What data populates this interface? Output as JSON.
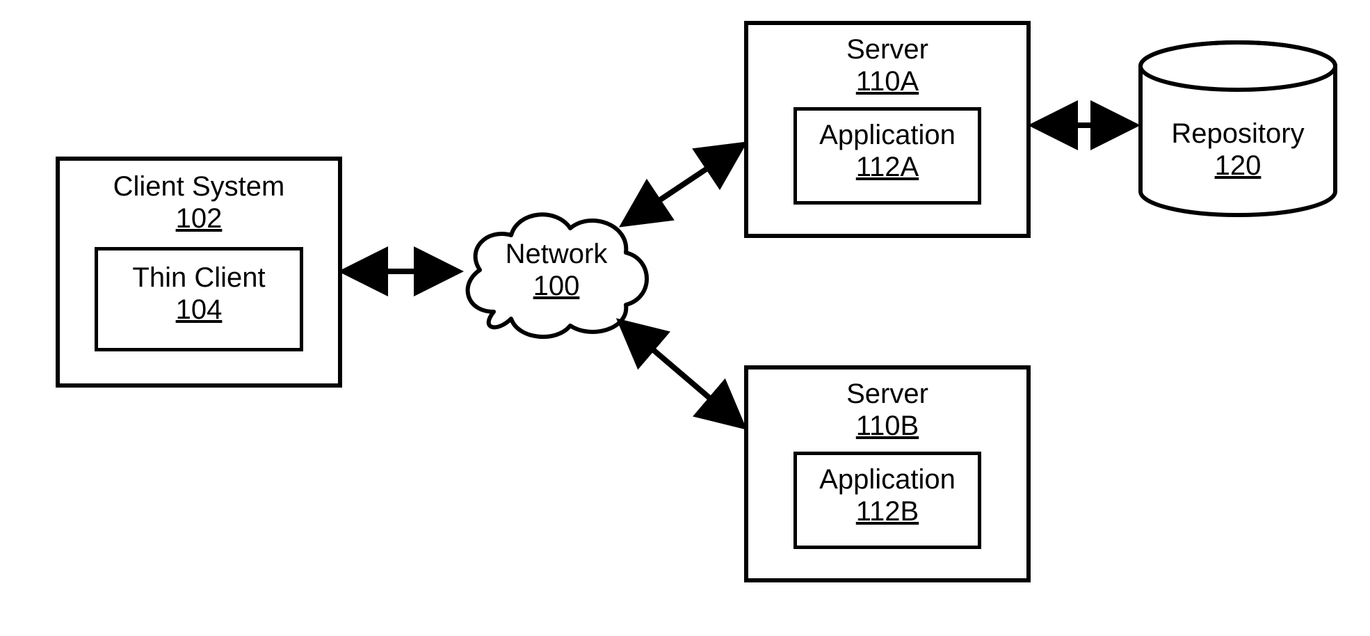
{
  "client": {
    "title": "Client System",
    "id": "102",
    "inner_title": "Thin Client",
    "inner_id": "104"
  },
  "network": {
    "title": "Network",
    "id": "100"
  },
  "serverA": {
    "title": "Server",
    "id": "110A",
    "inner_title": "Application",
    "inner_id": "112A"
  },
  "serverB": {
    "title": "Server",
    "id": "110B",
    "inner_title": "Application",
    "inner_id": "112B"
  },
  "repository": {
    "title": "Repository",
    "id": "120"
  }
}
